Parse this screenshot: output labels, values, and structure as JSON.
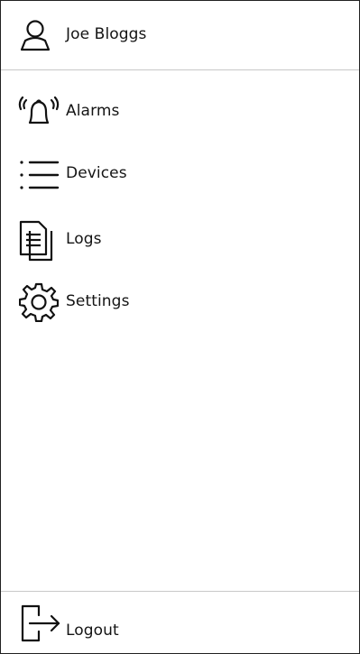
{
  "user": {
    "name": "Joe Bloggs",
    "icon": "person-icon"
  },
  "nav": {
    "items": [
      {
        "label": "Alarms",
        "icon": "alarm-bell-icon"
      },
      {
        "label": "Devices",
        "icon": "list-icon"
      },
      {
        "label": "Logs",
        "icon": "documents-icon"
      },
      {
        "label": "Settings",
        "icon": "gear-icon"
      }
    ]
  },
  "footer": {
    "logout_label": "Logout",
    "icon": "logout-icon"
  },
  "colors": {
    "border": "#222222",
    "divider": "#c8c8c8",
    "text": "#141414",
    "background": "#ffffff"
  }
}
